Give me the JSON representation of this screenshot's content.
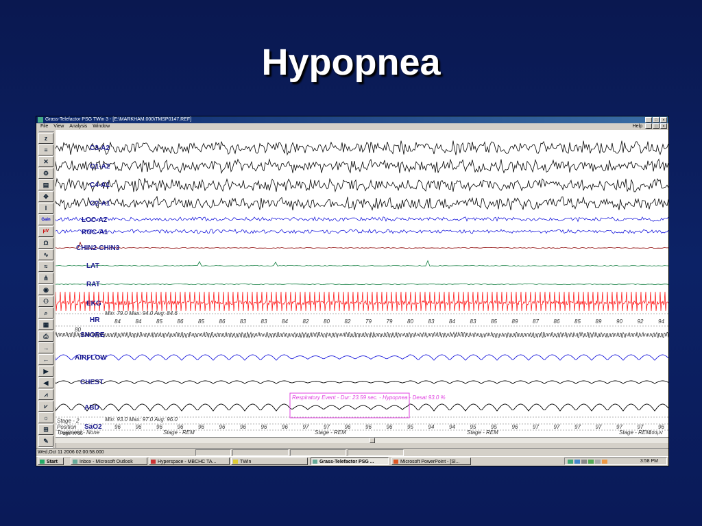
{
  "slide": {
    "title": "Hypopnea"
  },
  "window": {
    "title": "Grass-Telefactor PSG TWin 3 - [E:\\MARKHAM.000\\TMSP0147.REF]",
    "menu": [
      "File",
      "View",
      "Analysis",
      "Window"
    ],
    "help": "Help"
  },
  "channels": {
    "c3": "C3-A2",
    "o1": "O1-A2",
    "c4": "C4-A1",
    "o2": "O2-A1",
    "loc": "LOC-A2",
    "roc": "ROC-A1",
    "chin": "CHIN2-CHIN3",
    "lat": "LAT",
    "rat": "RAT",
    "ekg": "EKG",
    "hr": "HR",
    "snore": "SNORE",
    "airflow": "AIRFLOW",
    "chest": "CHEST",
    "abd": "ABD",
    "sao2": "SaO2"
  },
  "hr": {
    "stats": "Min: 79.0 Max: 94.0 Avg: 84.6",
    "values": [
      "84",
      "84",
      "85",
      "86",
      "85",
      "86",
      "83",
      "83",
      "84",
      "82",
      "80",
      "82",
      "79",
      "79",
      "80",
      "83",
      "84",
      "83",
      "85",
      "89",
      "87",
      "86",
      "85",
      "89",
      "90",
      "92",
      "94"
    ],
    "baseline": "80"
  },
  "sao2": {
    "stats": "Min: 93.0 Max: 97.0 Avg: 96.0",
    "values": [
      "96",
      "96",
      "96",
      "96",
      "96",
      "96",
      "96",
      "96",
      "96",
      "97",
      "97",
      "96",
      "96",
      "96",
      "95",
      "94",
      "94",
      "95",
      "95",
      "96",
      "97",
      "97",
      "97",
      "97",
      "97",
      "97",
      "96"
    ]
  },
  "event": {
    "label": "Respiratory Event - Dur: 23.59 sec. - Hypopnea - Desat 93.0 %"
  },
  "annotations": {
    "stage2": "Stage - 2",
    "position": "Position",
    "treatment": "Treatment - None",
    "page": "Page #765",
    "stage_rem": "Stage - REM",
    "scale": "100µV"
  },
  "status": {
    "datetime": "Wed,Oct 11 2006  02:00:58.000"
  },
  "taskbar": {
    "start": "Start",
    "tasks": [
      "Inbox - Microsoft Outlook",
      "Hyperspace - MBCHC TA...",
      "TWin",
      "Grass-Telefactor PSG ...",
      "Microsoft PowerPoint - [Sl..."
    ],
    "clock": "3:58 PM"
  },
  "toolbar_labels": {
    "gain": "Gain",
    "uv": "µV"
  },
  "colors": {
    "eeg": "#000000",
    "eog": "#1a1adc",
    "chin": "#8b0000",
    "leg": "#0a7a3a",
    "ekg": "#ff0000",
    "resp": "#1a1adc",
    "event": "#e040e0",
    "bg": "#0c2266"
  }
}
